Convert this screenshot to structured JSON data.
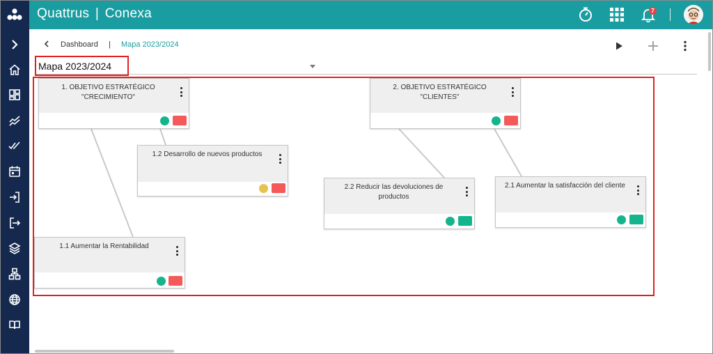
{
  "app": {
    "brand": "Quattrus",
    "separator": "|",
    "product": "Conexa",
    "notifications_count": "7"
  },
  "breadcrumb": {
    "dashboard": "Dashboard",
    "separator": "|",
    "current": "Mapa 2023/2024"
  },
  "map_select": {
    "value": "Mapa 2023/2024"
  },
  "cards": [
    {
      "title": "1. OBJETIVO ESTRATÉGICO\n\"CRECIMIENTO\"",
      "dot_color": "#14b48c",
      "status_color": "#f45a5a"
    },
    {
      "title": "1.2 Desarrollo de nuevos productos",
      "dot_color": "#e8c250",
      "status_color": "#f45a5a"
    },
    {
      "title": "1.1 Aumentar la Rentabilidad",
      "dot_color": "#14b48c",
      "status_color": "#f45a5a"
    },
    {
      "title": "2. OBJETIVO ESTRATÉGICO\n\"CLIENTES\"",
      "dot_color": "#14b48c",
      "status_color": "#f45a5a"
    },
    {
      "title": "2.2 Reducir las devoluciones de productos",
      "dot_color": "#14b48c",
      "status_color": "#14b48c"
    },
    {
      "title": "2.1 Aumentar la satisfacción del cliente",
      "dot_color": "#14b48c",
      "status_color": "#14b48c"
    }
  ],
  "colors": {
    "topbar": "#1a9da0",
    "sidebar": "#15294f",
    "accent": "#1a9da0",
    "highlight": "#e02020"
  },
  "icons": {
    "sidebar": [
      "chevron-right-icon",
      "home-icon",
      "dashboard-icon",
      "trend-icon",
      "double-check-icon",
      "calendar-icon",
      "login-icon",
      "export-icon",
      "layers-icon",
      "sitemap-icon",
      "globe-icon",
      "book-icon"
    ],
    "topbar": [
      "timer-icon",
      "apps-grid-icon",
      "bell-icon"
    ],
    "actions": [
      "play-icon",
      "add-icon",
      "more-vertical-icon"
    ]
  }
}
